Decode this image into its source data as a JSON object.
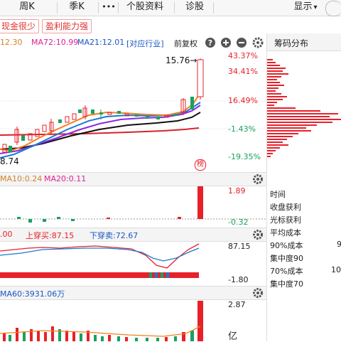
{
  "tabs": [
    {
      "label": "周K",
      "selected": false
    },
    {
      "label": "季K",
      "selected": false
    },
    {
      "label": "•••",
      "selected": false
    },
    {
      "label": "个股资料",
      "selected": false
    },
    {
      "label": "诊股",
      "selected": false
    }
  ],
  "display_menu": {
    "label": "显示",
    "caret": "▾"
  },
  "tags": [
    "现金很少",
    "盈利能力强"
  ],
  "ma_line": {
    "ma1": "12.30",
    "ma72": "MA72:10.99",
    "ma21": "MA21:12.01"
  },
  "industry_button": "[对应行业]",
  "adjust_label": "前复权",
  "chip_title": "筹码分布",
  "price_axis": {
    "p1": "43.37%",
    "p2": "34.41%",
    "p3": "16.49%",
    "p4": "-1.43%",
    "p5": "-19.35%"
  },
  "high_label": "15.76",
  "low_label": "8.74",
  "bang_badge": "榜",
  "vol_panel": {
    "header": "MA10:0.24",
    "header2": "MA20:0.11",
    "top": "1.89",
    "bottom": "-0.32"
  },
  "osc_panel": {
    "header1": ".00",
    "header2": "上穿买:87.15",
    "header3": "下穿卖:72.67",
    "top": "87.15",
    "bottom": "-1.80"
  },
  "amt_panel": {
    "header": "MA60:3931.06万",
    "top": "2.87",
    "bottom": "亿"
  },
  "chip_info": {
    "rows": [
      "时间",
      "收盘获利",
      "光标获利",
      "平均成本",
      "90%成本",
      "集中度90",
      "70%成本",
      "集中度70"
    ],
    "val_90": "9",
    "val_70": "10"
  },
  "colors": {
    "up": "#e8202a",
    "down": "#19a15f",
    "accent": "#1a56c4"
  }
}
